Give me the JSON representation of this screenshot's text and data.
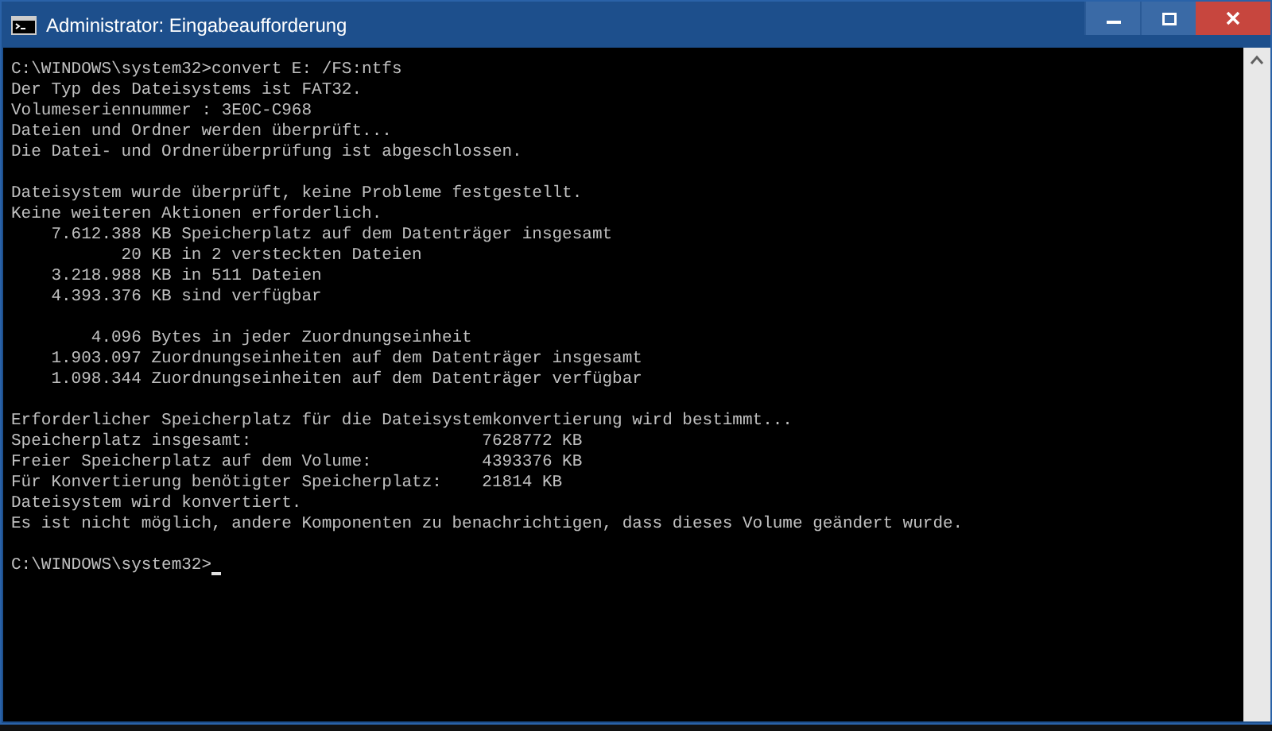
{
  "window": {
    "title": "Administrator: Eingabeaufforderung"
  },
  "console": {
    "blocks": [
      [
        "C:\\WINDOWS\\system32>convert E: /FS:ntfs",
        "Der Typ des Dateisystems ist FAT32.",
        "Volumeseriennummer : 3E0C-C968",
        "Dateien und Ordner werden überprüft...",
        "Die Datei- und Ordnerüberprüfung ist abgeschlossen."
      ],
      [
        "Dateisystem wurde überprüft, keine Probleme festgestellt.",
        "Keine weiteren Aktionen erforderlich.",
        "    7.612.388 KB Speicherplatz auf dem Datenträger insgesamt",
        "           20 KB in 2 versteckten Dateien",
        "    3.218.988 KB in 511 Dateien",
        "    4.393.376 KB sind verfügbar"
      ],
      [
        "        4.096 Bytes in jeder Zuordnungseinheit",
        "    1.903.097 Zuordnungseinheiten auf dem Datenträger insgesamt",
        "    1.098.344 Zuordnungseinheiten auf dem Datenträger verfügbar"
      ],
      [
        "Erforderlicher Speicherplatz für die Dateisystemkonvertierung wird bestimmt...",
        "Speicherplatz insgesamt:                       7628772 KB",
        "Freier Speicherplatz auf dem Volume:           4393376 KB",
        "Für Konvertierung benötigter Speicherplatz:    21814 KB",
        "Dateisystem wird konvertiert.",
        "Es ist nicht möglich, andere Komponenten zu benachrichtigen, dass dieses Volume geändert wurde."
      ]
    ],
    "prompt": "C:\\WINDOWS\\system32>"
  }
}
